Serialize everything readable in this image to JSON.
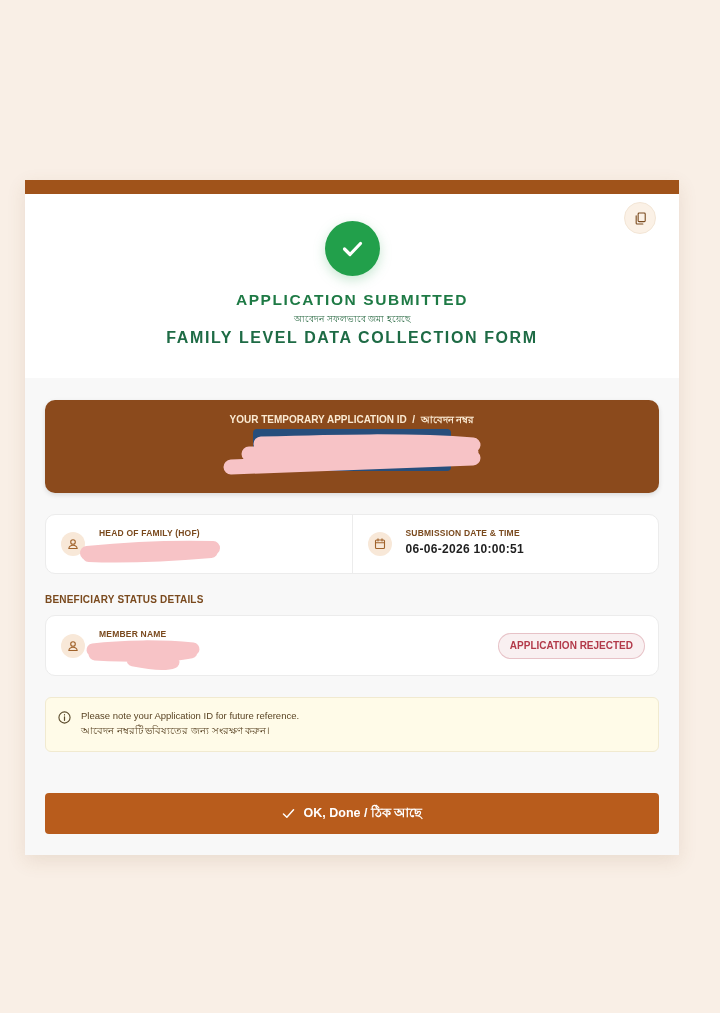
{
  "title": "APPLICATION SUBMITTED",
  "subtitle": "আবেদন সফলভাবে জমা হয়েছে",
  "form_name": "FAMILY LEVEL DATA COLLECTION FORM",
  "application_id": {
    "label": "YOUR TEMPORARY APPLICATION ID  /  আবেদন নম্বর",
    "redacted": true
  },
  "details": [
    {
      "kind": "person",
      "label": "HEAD OF FAMILY (HOF)",
      "redacted": true
    },
    {
      "kind": "calendar",
      "label": "SUBMISSION DATE & TIME",
      "value": "06-06-2026 10:00:51"
    }
  ],
  "beneficiary": {
    "heading": "BENEFICIARY STATUS DETAILS",
    "members": [
      {
        "label": "MEMBER NAME",
        "redacted": true,
        "status": "APPLICATION REJECTED",
        "color": "#b23a4a"
      }
    ]
  },
  "notice": {
    "lines": [
      "Please note your Application ID for future reference.",
      "আবেদন নম্বরটি ভবিষ্যতের জন্য সংরক্ষণ করুন।"
    ]
  },
  "done_button": {
    "label": "OK, Done / ঠিক আছে"
  }
}
